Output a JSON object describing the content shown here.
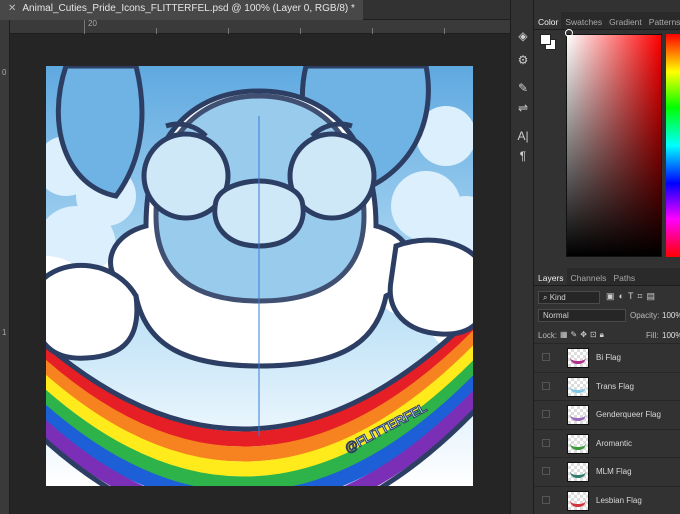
{
  "document": {
    "tab_title": "Animal_Cuties_Pride_Icons_FLITTERFEL.psd @ 100% (Layer 0, RGB/8) *",
    "close_glyph": "✕",
    "ruler_top_label": "20",
    "ruler_left_labels": [
      "0",
      "1"
    ],
    "watermark": "@FLITTERFEL"
  },
  "tools": [
    "3d-rotate-icon",
    "fx-icon",
    "brush-settings-icon",
    "adjust-icon",
    "text-icon",
    "paragraph-icon"
  ],
  "tool_glyphs": [
    "◈",
    "⚙",
    "✎",
    "⇌",
    "A|",
    "¶"
  ],
  "color_panel": {
    "tabs": [
      "Color",
      "Swatches",
      "Gradient",
      "Patterns"
    ],
    "active_tab": "Color",
    "foreground": "#ffffff",
    "background": "#ffffff",
    "hue": "#ff0000"
  },
  "layers_panel": {
    "tabs": [
      "Layers",
      "Channels",
      "Paths"
    ],
    "active_tab": "Layers",
    "kind_label": "Kind",
    "blend_mode": "Normal",
    "opacity_label": "Opacity:",
    "opacity_value": "100%",
    "lock_label": "Lock:",
    "fill_label": "Fill:",
    "fill_value": "100%",
    "layers": [
      {
        "name": "Bi Flag",
        "color": "#b0308e"
      },
      {
        "name": "Trans Flag",
        "color": "#7fc8e8"
      },
      {
        "name": "Genderqueer Flag",
        "color": "#9c6bbf"
      },
      {
        "name": "Aromantic",
        "color": "#3a9a3a"
      },
      {
        "name": "MLM Flag",
        "color": "#2f7d6f"
      },
      {
        "name": "Lesbian Flag",
        "color": "#d4353a"
      }
    ]
  },
  "colors": {
    "outline": "#2c3e63",
    "sky": "#6eb3e3",
    "rainbow": [
      "#e61e25",
      "#f78220",
      "#ffea1b",
      "#2db34a",
      "#1d5fd6",
      "#7b2fb7"
    ]
  }
}
